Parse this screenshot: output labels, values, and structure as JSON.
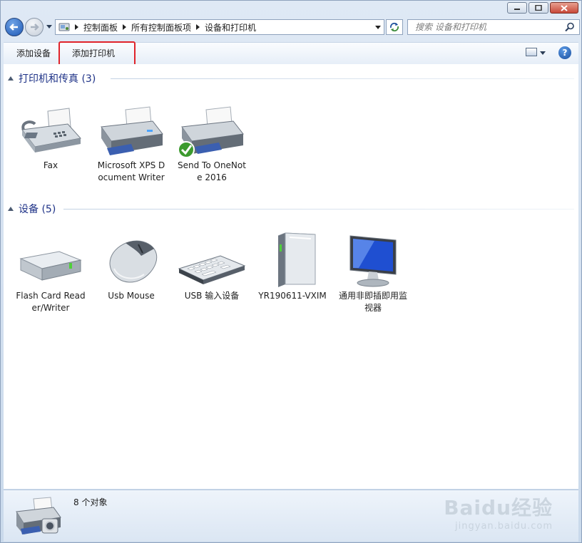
{
  "nav": {
    "breadcrumb": [
      "控制面板",
      "所有控制面板项",
      "设备和打印机"
    ],
    "search_placeholder": "搜索 设备和打印机"
  },
  "toolbar": {
    "add_device": "添加设备",
    "add_printer": "添加打印机",
    "help": "?"
  },
  "groups": {
    "printers": {
      "title": "打印机和传真 (3)",
      "items": [
        {
          "label": "Fax",
          "icon": "fax-icon"
        },
        {
          "label": "Microsoft XPS Document Writer",
          "icon": "printer-icon"
        },
        {
          "label": "Send To OneNote 2016",
          "icon": "printer-default-icon"
        }
      ]
    },
    "devices": {
      "title": "设备 (5)",
      "items": [
        {
          "label": "Flash Card Reader/Writer",
          "icon": "drive-icon"
        },
        {
          "label": "Usb Mouse",
          "icon": "mouse-icon"
        },
        {
          "label": "USB 输入设备",
          "icon": "keyboard-icon"
        },
        {
          "label": "YR190611-VXIM",
          "icon": "computer-tower-icon"
        },
        {
          "label": "通用非即插即用监视器",
          "icon": "monitor-icon"
        }
      ]
    }
  },
  "status": {
    "count": "8 个对象"
  },
  "watermark": {
    "logo": "Baidu经验",
    "url": "jingyan.baidu.com"
  },
  "colors": {
    "group_title": "#1e3287",
    "highlight": "#e0232a",
    "window_chrome": "#c9d9eb"
  }
}
